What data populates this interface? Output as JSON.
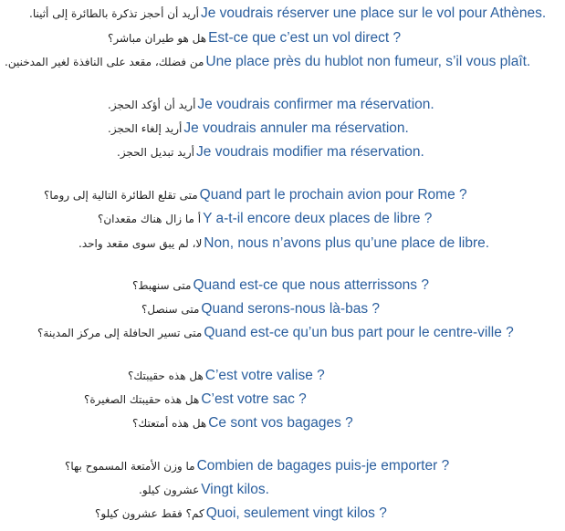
{
  "colors": {
    "background": "#ffffff",
    "arabic_text": "#222222",
    "french_text": "#2b5f9e"
  },
  "groups": [
    {
      "items": [
        {
          "ar": "أريد أن أحجز تذكرة بالطائرة إلى أثينا.",
          "fr": "Je voudrais réserver une place sur le vol pour Athènes."
        },
        {
          "ar": "هل هو طيران مباشر؟",
          "fr": "Est-ce que c’est un vol direct ?"
        },
        {
          "ar": "من فضلك، مقعد على النافذة لغير المدخنين.",
          "fr": "Une place près du hublot non fumeur, s’il vous plaît."
        }
      ]
    },
    {
      "items": [
        {
          "ar": "أريد أن أؤكد الحجز.",
          "fr": "Je voudrais confirmer ma réservation."
        },
        {
          "ar": "أريد إلغاء الحجز.",
          "fr": "Je voudrais annuler ma réservation."
        },
        {
          "ar": "أريد تبديل الحجز.",
          "fr": "Je voudrais modifier ma réservation."
        }
      ]
    },
    {
      "items": [
        {
          "ar": "متى تقلع الطائرة التالية إلى روما؟",
          "fr": "Quand part le prochain avion pour Rome ?"
        },
        {
          "ar": "أ ما زال هناك مقعدان؟",
          "fr": "Y a-t-il encore deux places de libre ?"
        },
        {
          "ar": "لا، لم يبق سوى مقعد واحد.",
          "fr": "Non, nous n’avons plus qu’une place de libre."
        }
      ]
    },
    {
      "items": [
        {
          "ar": "متى سنهبط؟",
          "fr": "Quand est-ce que nous atterrissons ?"
        },
        {
          "ar": "متى سنصل؟",
          "fr": "Quand serons-nous là-bas ?"
        },
        {
          "ar": "متى تسير الحافلة إلى مركز المدينة؟",
          "fr": "Quand est-ce qu’un bus part pour le centre-ville ?"
        }
      ]
    },
    {
      "items": [
        {
          "ar": "هل هذه حقيبتك؟",
          "fr": "C’est votre valise ?"
        },
        {
          "ar": "هل هذه حقيبتك الصغيرة؟",
          "fr": "C’est votre sac ?"
        },
        {
          "ar": "هل هذه أمتعتك؟",
          "fr": "Ce sont vos bagages ?"
        }
      ]
    },
    {
      "items": [
        {
          "ar": "ما وزن الأمتعة المسموح بها؟",
          "fr": "Combien de bagages puis-je emporter ?"
        },
        {
          "ar": "عشرون كيلو.",
          "fr": "Vingt kilos."
        },
        {
          "ar": "كم؟ فقط عشرون كيلو؟",
          "fr": "Quoi, seulement vingt kilos ?"
        }
      ]
    }
  ]
}
